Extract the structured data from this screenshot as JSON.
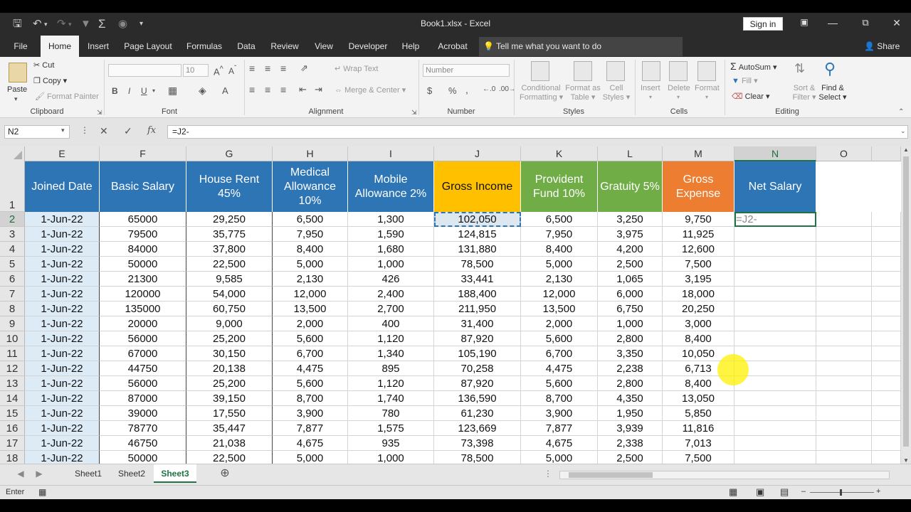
{
  "window": {
    "title": "Book1.xlsx  -  Excel",
    "sign_in": "Sign in"
  },
  "menu": {
    "tabs": [
      "File",
      "Home",
      "Insert",
      "Page Layout",
      "Formulas",
      "Data",
      "Review",
      "View",
      "Developer",
      "Help",
      "Acrobat"
    ],
    "active_tab": "Home",
    "tell_me": "Tell me what you want to do",
    "share": "Share"
  },
  "ribbon": {
    "clipboard": {
      "paste": "Paste",
      "cut": "Cut",
      "copy": "Copy",
      "format_painter": "Format Painter",
      "label": "Clipboard"
    },
    "font": {
      "size": "10",
      "label": "Font",
      "bold": "B",
      "italic": "I",
      "underline": "U"
    },
    "alignment": {
      "wrap_text": "Wrap Text",
      "merge_center": "Merge & Center",
      "label": "Alignment"
    },
    "number": {
      "format": "Number",
      "currency": "$",
      "percent": "%",
      "comma": ",",
      "label": "Number"
    },
    "styles": {
      "conditional": "Conditional",
      "conditional2": "Formatting",
      "format_as": "Format as",
      "format_as2": "Table",
      "cell_styles": "Cell",
      "cell_styles2": "Styles",
      "label": "Styles"
    },
    "cells": {
      "insert": "Insert",
      "delete": "Delete",
      "format": "Format",
      "label": "Cells"
    },
    "editing": {
      "autosum": "AutoSum",
      "fill": "Fill",
      "clear": "Clear",
      "sort": "Sort &",
      "sort2": "Filter",
      "find": "Find &",
      "find2": "Select",
      "label": "Editing"
    }
  },
  "formula_bar": {
    "name_box": "N2",
    "formula": "=J2-",
    "cancel": "✕",
    "enter": "✓",
    "fx": "fx"
  },
  "columns": [
    {
      "letter": "E",
      "header": "Joined Date",
      "color": "#2e75b6"
    },
    {
      "letter": "F",
      "header": "Basic Salary",
      "color": "#2e75b6"
    },
    {
      "letter": "G",
      "header": "House Rent 45%",
      "color": "#2e75b6"
    },
    {
      "letter": "H",
      "header": "Medical Allowance 10%",
      "color": "#2e75b6"
    },
    {
      "letter": "I",
      "header": "Mobile Allowance 2%",
      "color": "#2e75b6"
    },
    {
      "letter": "J",
      "header": "Gross Income",
      "color": "#ffc000",
      "text_color": "#111111"
    },
    {
      "letter": "K",
      "header": "Provident Fund 10%",
      "color": "#70ad47"
    },
    {
      "letter": "L",
      "header": "Gratuity 5%",
      "color": "#70ad47"
    },
    {
      "letter": "M",
      "header": "Gross Expense",
      "color": "#ed7d31"
    },
    {
      "letter": "N",
      "header": "Net Salary",
      "color": "#2e75b6"
    },
    {
      "letter": "O",
      "header": "",
      "color": ""
    }
  ],
  "rows": [
    {
      "num": "2",
      "cells": [
        "1-Jun-22",
        "65000",
        "29,250",
        "6,500",
        "1,300",
        "102,050",
        "6,500",
        "3,250",
        "9,750",
        "=J2-"
      ]
    },
    {
      "num": "3",
      "cells": [
        "1-Jun-22",
        "79500",
        "35,775",
        "7,950",
        "1,590",
        "124,815",
        "7,950",
        "3,975",
        "11,925",
        ""
      ]
    },
    {
      "num": "4",
      "cells": [
        "1-Jun-22",
        "84000",
        "37,800",
        "8,400",
        "1,680",
        "131,880",
        "8,400",
        "4,200",
        "12,600",
        ""
      ]
    },
    {
      "num": "5",
      "cells": [
        "1-Jun-22",
        "50000",
        "22,500",
        "5,000",
        "1,000",
        "78,500",
        "5,000",
        "2,500",
        "7,500",
        ""
      ]
    },
    {
      "num": "6",
      "cells": [
        "1-Jun-22",
        "21300",
        "9,585",
        "2,130",
        "426",
        "33,441",
        "2,130",
        "1,065",
        "3,195",
        ""
      ]
    },
    {
      "num": "7",
      "cells": [
        "1-Jun-22",
        "120000",
        "54,000",
        "12,000",
        "2,400",
        "188,400",
        "12,000",
        "6,000",
        "18,000",
        ""
      ]
    },
    {
      "num": "8",
      "cells": [
        "1-Jun-22",
        "135000",
        "60,750",
        "13,500",
        "2,700",
        "211,950",
        "13,500",
        "6,750",
        "20,250",
        ""
      ]
    },
    {
      "num": "9",
      "cells": [
        "1-Jun-22",
        "20000",
        "9,000",
        "2,000",
        "400",
        "31,400",
        "2,000",
        "1,000",
        "3,000",
        ""
      ]
    },
    {
      "num": "10",
      "cells": [
        "1-Jun-22",
        "56000",
        "25,200",
        "5,600",
        "1,120",
        "87,920",
        "5,600",
        "2,800",
        "8,400",
        ""
      ]
    },
    {
      "num": "11",
      "cells": [
        "1-Jun-22",
        "67000",
        "30,150",
        "6,700",
        "1,340",
        "105,190",
        "6,700",
        "3,350",
        "10,050",
        ""
      ]
    },
    {
      "num": "12",
      "cells": [
        "1-Jun-22",
        "44750",
        "20,138",
        "4,475",
        "895",
        "70,258",
        "4,475",
        "2,238",
        "6,713",
        ""
      ]
    },
    {
      "num": "13",
      "cells": [
        "1-Jun-22",
        "56000",
        "25,200",
        "5,600",
        "1,120",
        "87,920",
        "5,600",
        "2,800",
        "8,400",
        ""
      ]
    },
    {
      "num": "14",
      "cells": [
        "1-Jun-22",
        "87000",
        "39,150",
        "8,700",
        "1,740",
        "136,590",
        "8,700",
        "4,350",
        "13,050",
        ""
      ]
    },
    {
      "num": "15",
      "cells": [
        "1-Jun-22",
        "39000",
        "17,550",
        "3,900",
        "780",
        "61,230",
        "3,900",
        "1,950",
        "5,850",
        ""
      ]
    },
    {
      "num": "16",
      "cells": [
        "1-Jun-22",
        "78770",
        "35,447",
        "7,877",
        "1,575",
        "123,669",
        "7,877",
        "3,939",
        "11,816",
        ""
      ]
    },
    {
      "num": "17",
      "cells": [
        "1-Jun-22",
        "46750",
        "21,038",
        "4,675",
        "935",
        "73,398",
        "4,675",
        "2,338",
        "7,013",
        ""
      ]
    },
    {
      "num": "18",
      "cells": [
        "1-Jun-22",
        "50000",
        "22,500",
        "5,000",
        "1,000",
        "78,500",
        "5,000",
        "2,500",
        "7,500",
        ""
      ]
    }
  ],
  "header_row_num": "1",
  "selected_column": "N",
  "selected_row": "2",
  "sheets": [
    "Sheet1",
    "Sheet2",
    "Sheet3"
  ],
  "active_sheet": "Sheet3",
  "status": {
    "mode": "Enter"
  }
}
